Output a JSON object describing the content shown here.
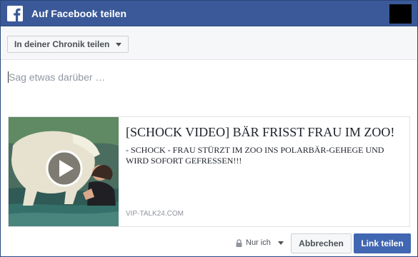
{
  "header": {
    "title": "Auf Facebook teilen",
    "logo_icon": "facebook-logo-icon",
    "background_color": "#3b5998"
  },
  "toolbar": {
    "share_target": "In deiner Chronik teilen",
    "caret_icon": "chevron-down-icon"
  },
  "composer": {
    "placeholder": "Sag etwas darüber …",
    "value": ""
  },
  "link_preview": {
    "thumbnail_icon": "play-icon",
    "title": "[SCHOCK VIDEO] BÄR FRISST FRAU IM ZOO!",
    "description": "- SCHOCK - FRAU STÜRZT IM ZOO INS POLARBÄR-GEHEGE UND WIRD SOFORT GEFRESSEN!!!",
    "domain": "VIP-TALK24.COM"
  },
  "footer": {
    "privacy_icon": "lock-icon",
    "privacy_label": "Nur ich",
    "cancel_label": "Abbrechen",
    "share_label": "Link teilen",
    "accent_color": "#4267b2"
  }
}
